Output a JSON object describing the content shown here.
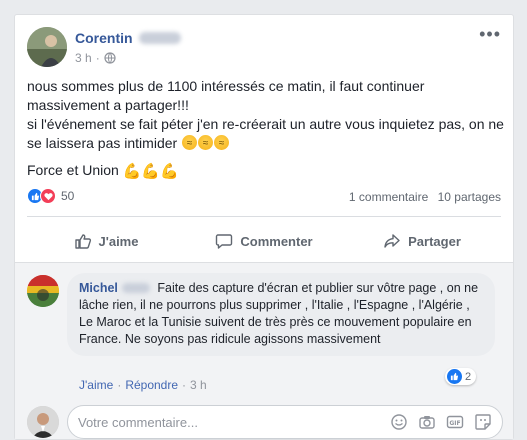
{
  "post": {
    "author_name": "Corentin",
    "time": "3 h",
    "separator": "·",
    "more": "•••",
    "paragraphs": {
      "p1": "nous sommes plus de 1100 intéressés ce matin, il faut continuer massivement a partager!!!",
      "p2": "si l'événement se fait péter j'en re-créerait un autre vous inquietez pas, on ne se laissera pas intimider",
      "p3": "Force et Union"
    },
    "emoji": {
      "angry": [
        "angry-face-emoji",
        "angry-face-emoji",
        "angry-face-emoji"
      ],
      "flex": "💪💪💪"
    }
  },
  "stats": {
    "reaction_count": "50",
    "comments": "1 commentaire",
    "shares": "10 partages",
    "reaction_icons": [
      "like-reaction-icon",
      "love-reaction-icon"
    ]
  },
  "actions": {
    "like": "J'aime",
    "comment": "Commenter",
    "share": "Partager"
  },
  "comment": {
    "author": "Michel",
    "text": "Faite des capture d'écran et publier sur vôtre page , on ne lâche rien, il ne pourrons plus supprimer , l'Italie , l'Espagne , l'Algérie , Le Maroc et la Tunisie suivent de très près ce mouvement populaire en France. Ne soyons pas ridicule agissons massivement",
    "like_count": "2",
    "like_label": "J'aime",
    "reply_label": "Répondre",
    "time": "3 h",
    "dot": "·"
  },
  "composer": {
    "placeholder": "Votre commentaire..."
  },
  "colors": {
    "link": "#365899",
    "like_blue": "#1877f2",
    "love_red": "#f33e58",
    "muted": "#606770"
  }
}
